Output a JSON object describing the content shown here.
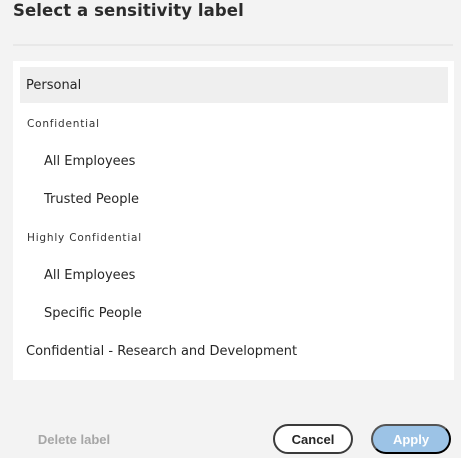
{
  "dialog": {
    "title": "Select a sensitivity label"
  },
  "labels": {
    "personal": "Personal",
    "confidential_header": "Confidential",
    "confidential_all_employees": "All Employees",
    "confidential_trusted_people": "Trusted People",
    "highly_confidential_header": "Highly Confidential",
    "highly_confidential_all_employees": "All Employees",
    "highly_confidential_specific_people": "Specific People",
    "confidential_research": "Confidential - Research and Development"
  },
  "buttons": {
    "delete_label": "Delete label",
    "cancel_label": "Cancel",
    "apply_label": "Apply"
  },
  "colors": {
    "selected_row": "#efefef",
    "apply_disabled": "#9cc3e6",
    "delete_disabled_text": "#a6a6a6"
  }
}
